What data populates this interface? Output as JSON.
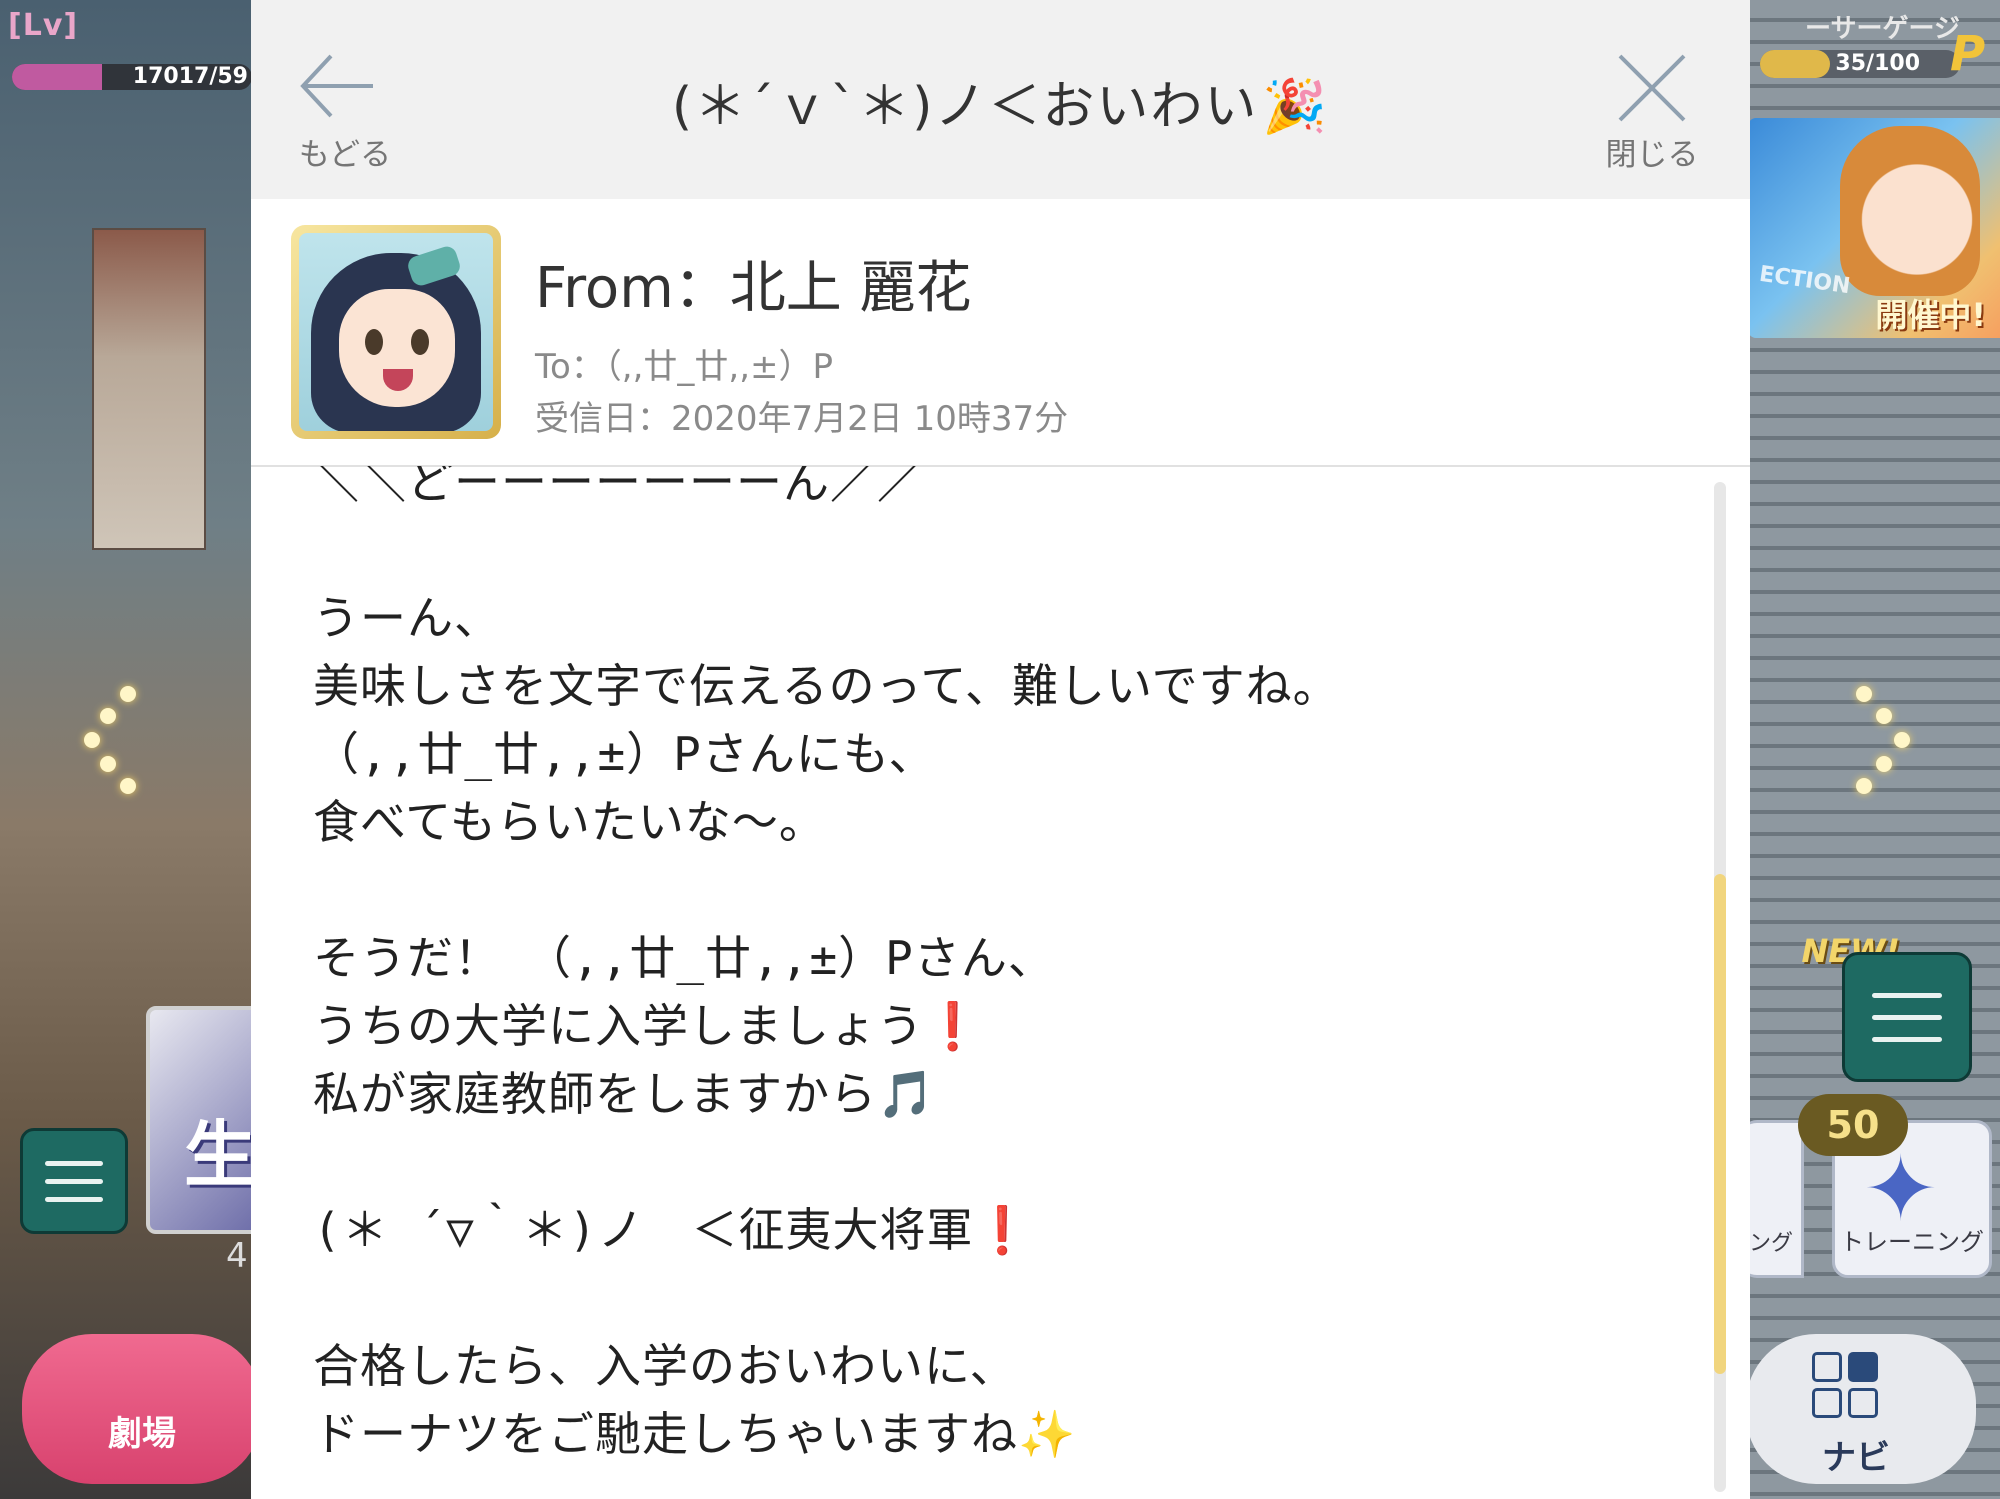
{
  "game": {
    "lv_label": "[Lv]",
    "lv_value": "17017/59",
    "gauge_label": "ーサーゲージ",
    "gauge_value": "35/100",
    "p_icon": "P",
    "event_label": "開催中!",
    "event_sub": "ECTION",
    "new_label": "NEW!",
    "card_text": "生",
    "card_num": "4",
    "theater_label": "劇場",
    "training_badge": "50",
    "training_label": "トレーニング",
    "training_label_partial": "ング",
    "navi_label": "ナビ"
  },
  "dialog": {
    "back_label": "もどる",
    "close_label": "閉じる",
    "title": "(＊´ｖ`＊)ノ＜おいわい",
    "title_emoji": "🎉"
  },
  "sender": {
    "from": "From：北上 麗花",
    "to": "To：（,,廿_廿,,±）P",
    "date": "受信日：2020年7月2日 10時37分"
  },
  "message": {
    "body": "＼＼どーーーーーーーん／／\n\nうーん、\n美味しさを文字で伝えるのって、難しいですね。\n（,,廿_廿,,±）Pさんにも、\n食べてもらいたいな～。\n\nそうだ！　（,,廿_廿,,±）Pさん、\nうちの大学に入学しましょう❗\n私が家庭教師をしますから🎵\n\n(＊ ´▽｀＊)ノ　＜征夷大将軍❗\n\n合格したら、入学のおいわいに、\nドーナツをご馳走しちゃいますね✨"
  },
  "colors": {
    "accent_scroll": "#f1d57e",
    "header_bg": "#f1f1f1",
    "text_primary": "#333333",
    "text_secondary": "#8a8a8a"
  }
}
